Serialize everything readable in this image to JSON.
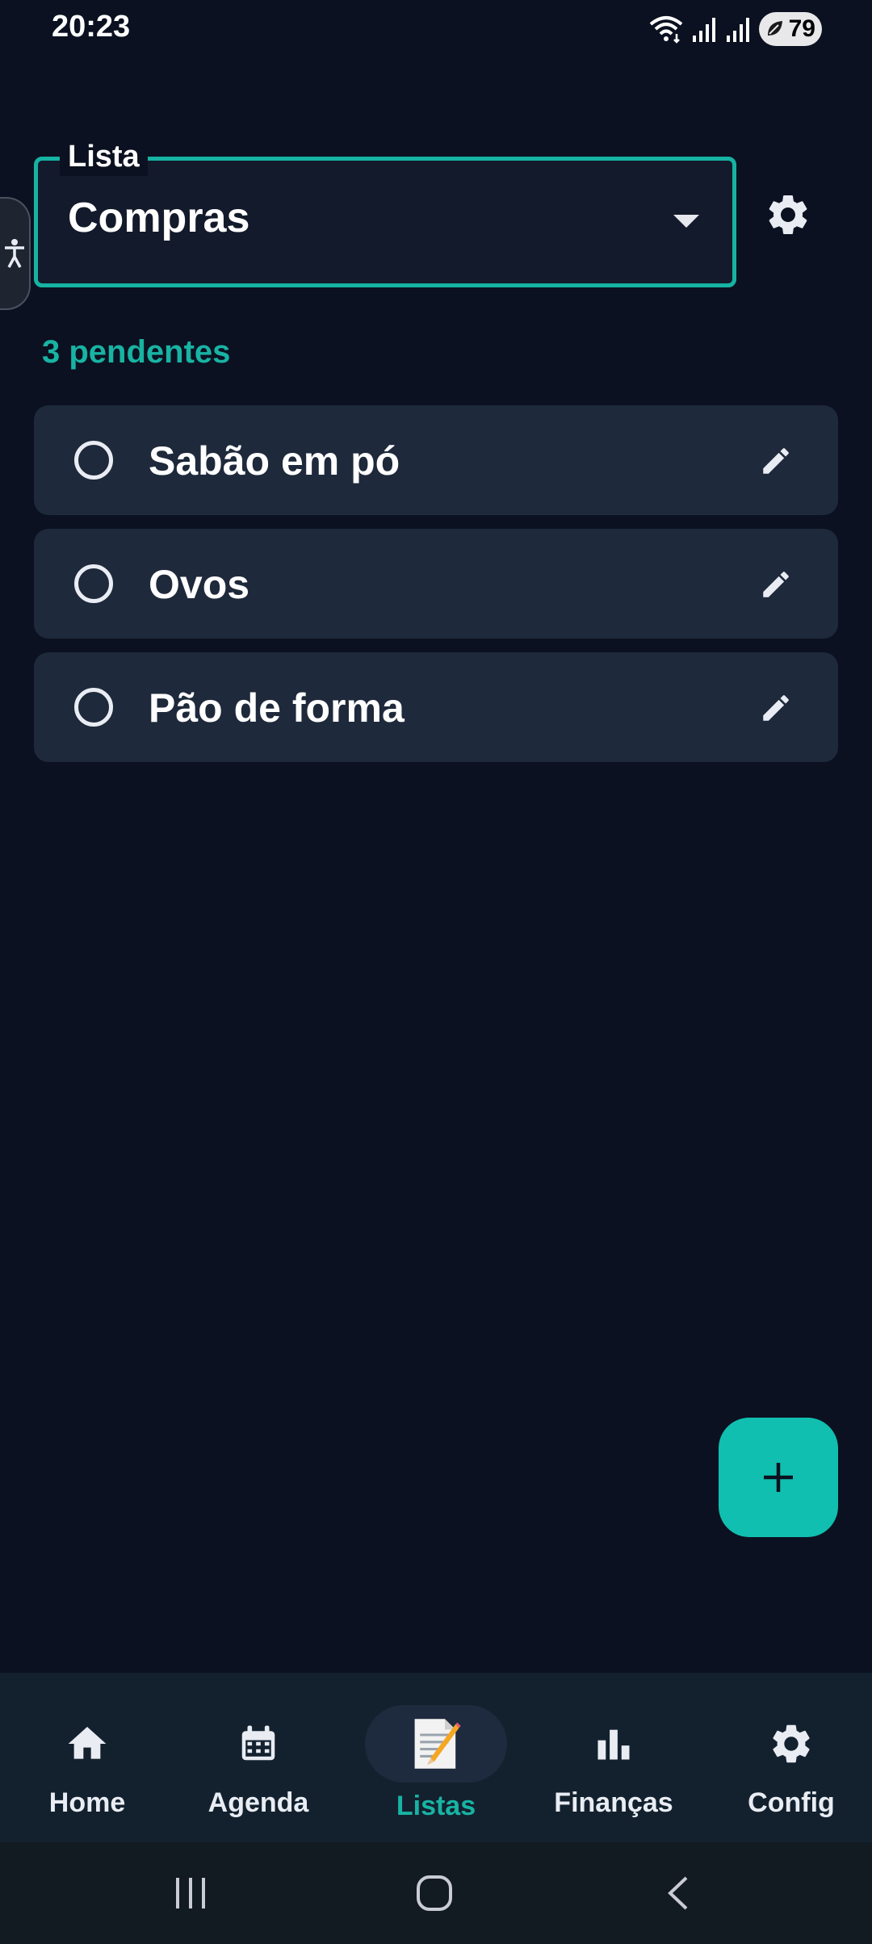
{
  "status_bar": {
    "time": "20:23",
    "battery": "79",
    "icons": [
      "wifi-icon",
      "signal-icon",
      "signal-icon",
      "battery-icon"
    ]
  },
  "list_selector": {
    "label": "Lista",
    "value": "Compras"
  },
  "pending_count": "3 pendentes",
  "items": [
    {
      "text": "Sabão em pó"
    },
    {
      "text": "Ovos"
    },
    {
      "text": "Pão de forma"
    }
  ],
  "bottom_nav": {
    "items": [
      {
        "label": "Home",
        "icon": "home-icon"
      },
      {
        "label": "Agenda",
        "icon": "calendar-icon"
      },
      {
        "label": "Listas",
        "icon": "memo-icon",
        "active": true
      },
      {
        "label": "Finanças",
        "icon": "bar-chart-icon"
      },
      {
        "label": "Config",
        "icon": "gear-icon"
      }
    ]
  },
  "colors": {
    "accent": "#18b3a3",
    "background": "#0b1120",
    "card": "#1e293b",
    "nav_background": "#13212f"
  }
}
